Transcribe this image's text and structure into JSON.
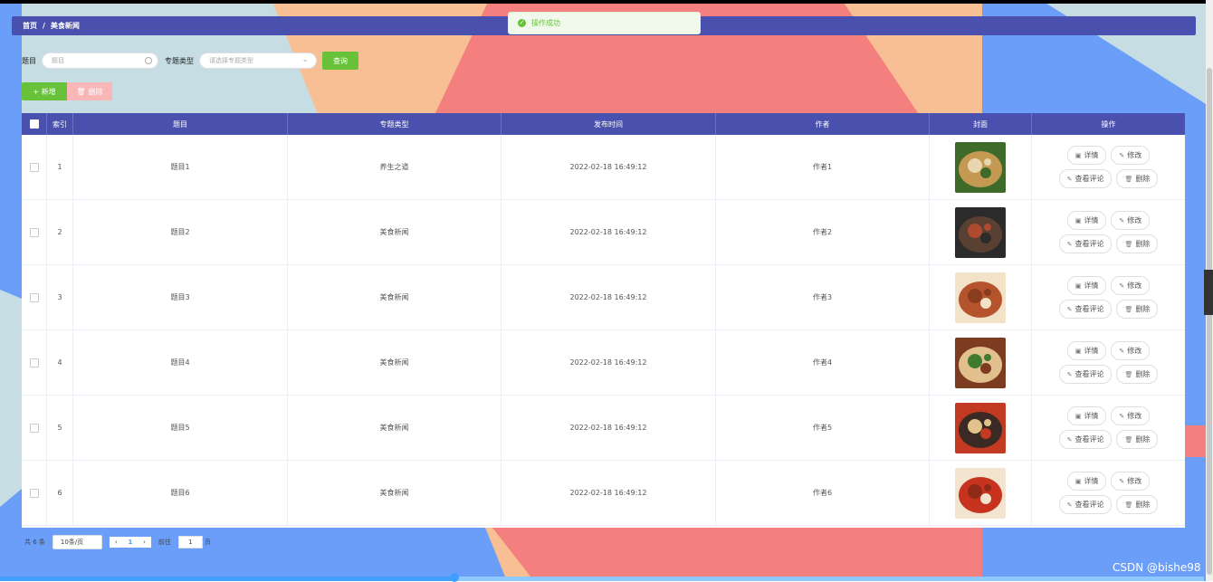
{
  "breadcrumb": {
    "home": "首页",
    "separator": "/",
    "current": "美食新闻"
  },
  "toast": {
    "message": "操作成功",
    "icon": "success-check-icon"
  },
  "search": {
    "title_label": "题目",
    "title_placeholder": "题目",
    "type_label": "专题类型",
    "type_placeholder": "请选择专题类型",
    "query_button": "查询"
  },
  "actions": {
    "add_label": "+ 新增",
    "delete_label": "删除"
  },
  "table": {
    "headers": [
      "",
      "索引",
      "题目",
      "专题类型",
      "发布时间",
      "作者",
      "封面",
      "操作"
    ],
    "rows": [
      {
        "index": "1",
        "title": "题目1",
        "type": "养生之道",
        "time": "2022-02-18 16:49:12",
        "author": "作者1"
      },
      {
        "index": "2",
        "title": "题目2",
        "type": "美食新闻",
        "time": "2022-02-18 16:49:12",
        "author": "作者2"
      },
      {
        "index": "3",
        "title": "题目3",
        "type": "美食新闻",
        "time": "2022-02-18 16:49:12",
        "author": "作者3"
      },
      {
        "index": "4",
        "title": "题目4",
        "type": "美食新闻",
        "time": "2022-02-18 16:49:12",
        "author": "作者4"
      },
      {
        "index": "5",
        "title": "题目5",
        "type": "美食新闻",
        "time": "2022-02-18 16:49:12",
        "author": "作者5"
      },
      {
        "index": "6",
        "title": "题目6",
        "type": "美食新闻",
        "time": "2022-02-18 16:49:12",
        "author": "作者6"
      }
    ],
    "op_labels": {
      "detail": "详情",
      "edit": "修改",
      "comments": "查看评论",
      "delete": "删除"
    }
  },
  "pagination": {
    "total": "共 6 条",
    "page_size": "10条/页",
    "current_page": "1",
    "goto_label": "前往",
    "goto_value": "1",
    "goto_suffix": "页"
  },
  "watermark": "CSDN @bishe98",
  "colors": {
    "header": "#4a50ad",
    "success": "#67c23a",
    "danger_light": "#f9b6b6",
    "bg_blue": "#6a9ef8",
    "bg_peach": "#f7bf93",
    "bg_red": "#f47f7f"
  }
}
